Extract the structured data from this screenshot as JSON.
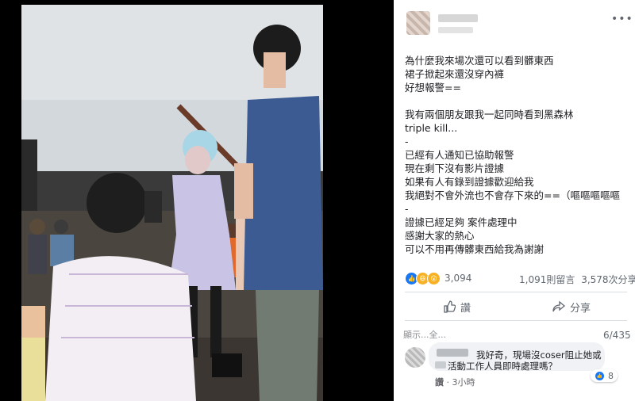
{
  "post": {
    "lines": [
      "為什麼我來場次還可以看到髒東西",
      "裙子掀起來還沒穿內褲",
      "好想報警==",
      "",
      "我有兩個朋友跟我一起同時看到黑森林",
      "triple kill...",
      "-",
      "已經有人通知已協助報警",
      "現在剩下沒有影片證據",
      "如果有人有錄到證據歡迎給我",
      "我絕對不會外流也不會存下來的==（嘔嘔嘔嘔嘔",
      "-",
      "證據已經足夠 案件處理中",
      "感謝大家的熱心",
      "可以不用再傳髒東西給我為謝謝"
    ]
  },
  "header": {
    "more_icon": "more-horizontal-icon",
    "more_label": "•••"
  },
  "reactions": {
    "icons": [
      "like-icon",
      "haha-icon",
      "wow-icon"
    ],
    "count": "3,094"
  },
  "stats": {
    "comments": "1,091則留言",
    "shares": "3,578次分享"
  },
  "actions": {
    "like_label": "讚",
    "share_label": "分享"
  },
  "comments": {
    "sort_label": "顯示...全...",
    "count_label": "6/435",
    "first": {
      "line1": "我好奇，現場沒coser阻止她或",
      "line2": "活動工作人員即時處理嗎？",
      "likes": "8",
      "like_action": "讚",
      "time": "3小時"
    }
  },
  "colors": {
    "accent": "#1877f2",
    "text": "#1c1e21",
    "muted": "#606770"
  }
}
